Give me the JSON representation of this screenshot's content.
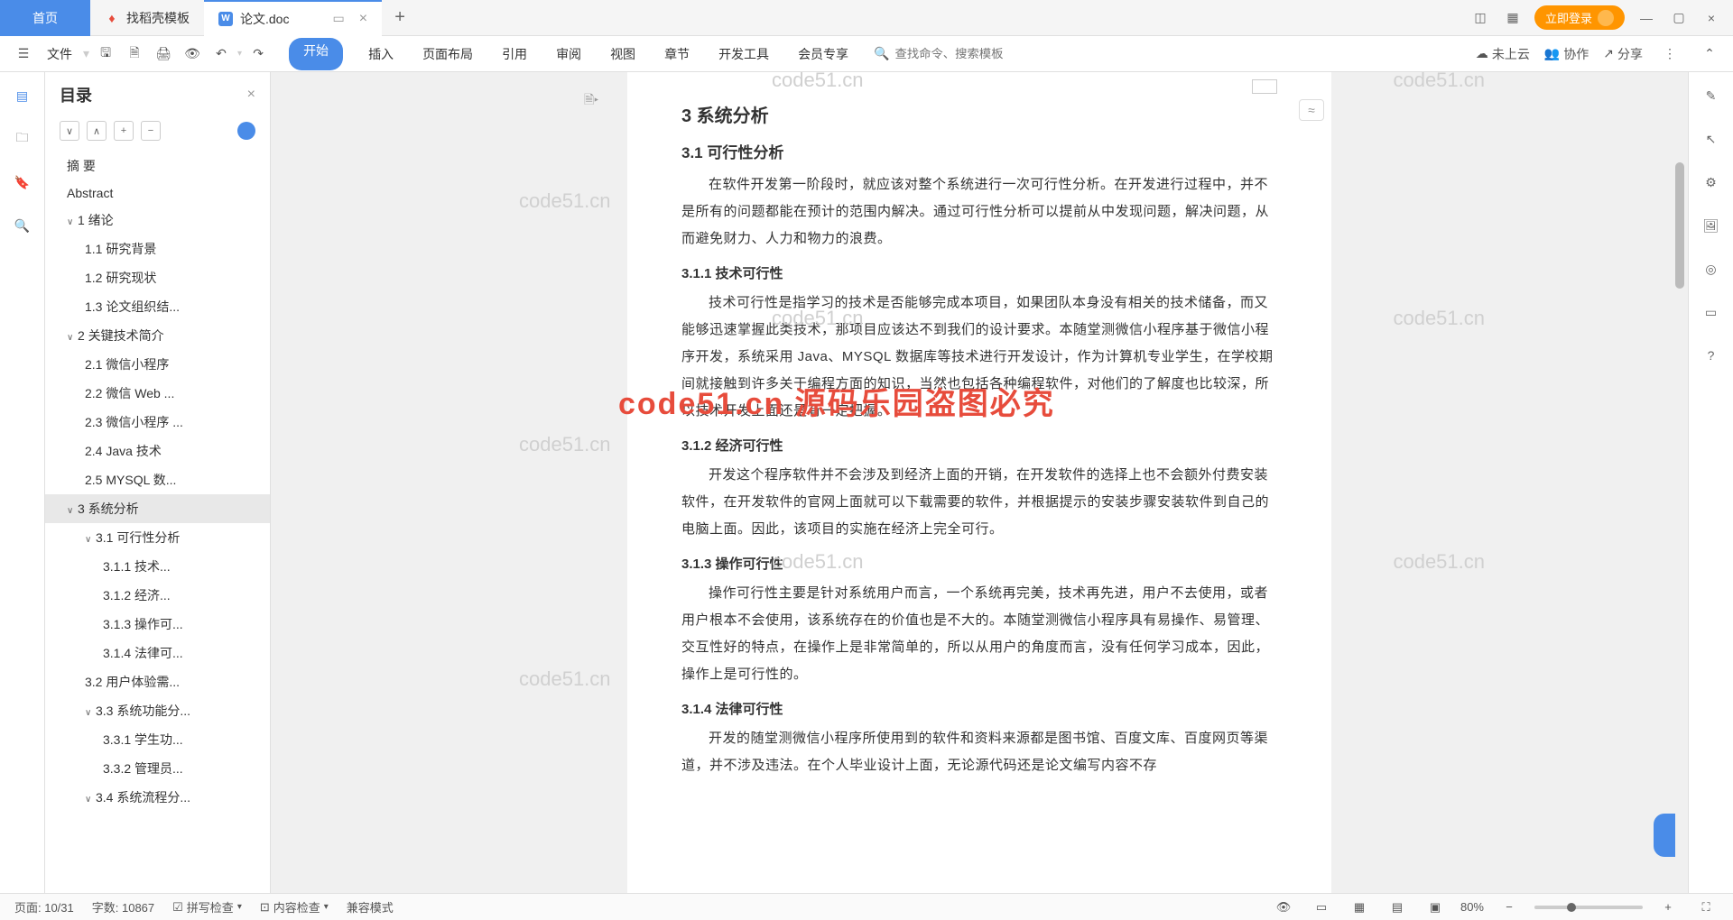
{
  "tabs": {
    "home": "首页",
    "t1": "找稻壳模板",
    "t2": "论文.doc"
  },
  "login_btn": "立即登录",
  "file_menu": "文件",
  "menus": [
    "开始",
    "插入",
    "页面布局",
    "引用",
    "审阅",
    "视图",
    "章节",
    "开发工具",
    "会员专享"
  ],
  "search_placeholder": "查找命令、搜索模板",
  "cloud_status": "未上云",
  "collab": "协作",
  "share": "分享",
  "outline": {
    "title": "目录",
    "items": [
      {
        "lvl": 0,
        "txt": "摘  要"
      },
      {
        "lvl": 0,
        "txt": "Abstract"
      },
      {
        "lvl": 1,
        "caret": "∨",
        "txt": "1   绪论"
      },
      {
        "lvl": 2,
        "txt": "1.1 研究背景"
      },
      {
        "lvl": 2,
        "txt": "1.2 研究现状"
      },
      {
        "lvl": 2,
        "txt": "1.3 论文组织结..."
      },
      {
        "lvl": 1,
        "caret": "∨",
        "txt": "2   关键技术简介"
      },
      {
        "lvl": 2,
        "txt": "2.1 微信小程序"
      },
      {
        "lvl": 2,
        "txt": "2.2 微信 Web ..."
      },
      {
        "lvl": 2,
        "txt": "2.3 微信小程序 ..."
      },
      {
        "lvl": 2,
        "txt": "2.4 Java 技术"
      },
      {
        "lvl": 2,
        "txt": "2.5 MYSQL 数..."
      },
      {
        "lvl": 1,
        "caret": "∨",
        "txt": "3   系统分析",
        "sel": true
      },
      {
        "lvl": 2,
        "caret": "∨",
        "txt": "3.1 可行性分析"
      },
      {
        "lvl": 3,
        "txt": "3.1.1 技术..."
      },
      {
        "lvl": 3,
        "txt": "3.1.2 经济..."
      },
      {
        "lvl": 3,
        "txt": "3.1.3 操作可..."
      },
      {
        "lvl": 3,
        "txt": "3.1.4 法律可..."
      },
      {
        "lvl": 2,
        "txt": "3.2 用户体验需..."
      },
      {
        "lvl": 2,
        "caret": "∨",
        "txt": "3.3 系统功能分..."
      },
      {
        "lvl": 3,
        "txt": "3.3.1 学生功..."
      },
      {
        "lvl": 3,
        "txt": "3.3.2 管理员..."
      },
      {
        "lvl": 2,
        "caret": "∨",
        "txt": "3.4 系统流程分..."
      }
    ]
  },
  "doc": {
    "h1": "3   系统分析",
    "s31": "3.1  可行性分析",
    "p31": "在软件开发第一阶段时，就应该对整个系统进行一次可行性分析。在开发进行过程中，并不是所有的问题都能在预计的范围内解决。通过可行性分析可以提前从中发现问题，解决问题，从而避免财力、人力和物力的浪费。",
    "s311": "3.1.1 技术可行性",
    "p311": "技术可行性是指学习的技术是否能够完成本项目，如果团队本身没有相关的技术储备，而又能够迅速掌握此类技术，那项目应该达不到我们的设计要求。本随堂测微信小程序基于微信小程序开发，系统采用 Java、MYSQL 数据库等技术进行开发设计，作为计算机专业学生，在学校期间就接触到许多关于编程方面的知识，当然也包括各种编程软件，对他们的了解度也比较深，所以技术开发上面还是有一定把握。",
    "s312": "3.1.2 经济可行性",
    "p312": "开发这个程序软件并不会涉及到经济上面的开销，在开发软件的选择上也不会额外付费安装软件，在开发软件的官网上面就可以下载需要的软件，并根据提示的安装步骤安装软件到自己的电脑上面。因此，该项目的实施在经济上完全可行。",
    "s313": "3.1.3 操作可行性",
    "p313": "操作可行性主要是针对系统用户而言，一个系统再完美，技术再先进，用户不去使用，或者用户根本不会使用，该系统存在的价值也是不大的。本随堂测微信小程序具有易操作、易管理、交互性好的特点，在操作上是非常简单的，所以从用户的角度而言，没有任何学习成本，因此，操作上是可行性的。",
    "s314": "3.1.4 法律可行性",
    "p314": "开发的随堂测微信小程序所使用到的软件和资料来源都是图书馆、百度文库、百度网页等渠道，并不涉及违法。在个人毕业设计上面，无论源代码还是论文编写内容不存"
  },
  "watermarks": {
    "wm": "code51.cn",
    "big": "code51.cn  源码乐园盗图必究"
  },
  "status": {
    "page": "页面: 10/31",
    "words": "字数: 10867",
    "spell": "拼写检查",
    "content": "内容检查",
    "compat": "兼容模式",
    "zoom": "80%"
  }
}
